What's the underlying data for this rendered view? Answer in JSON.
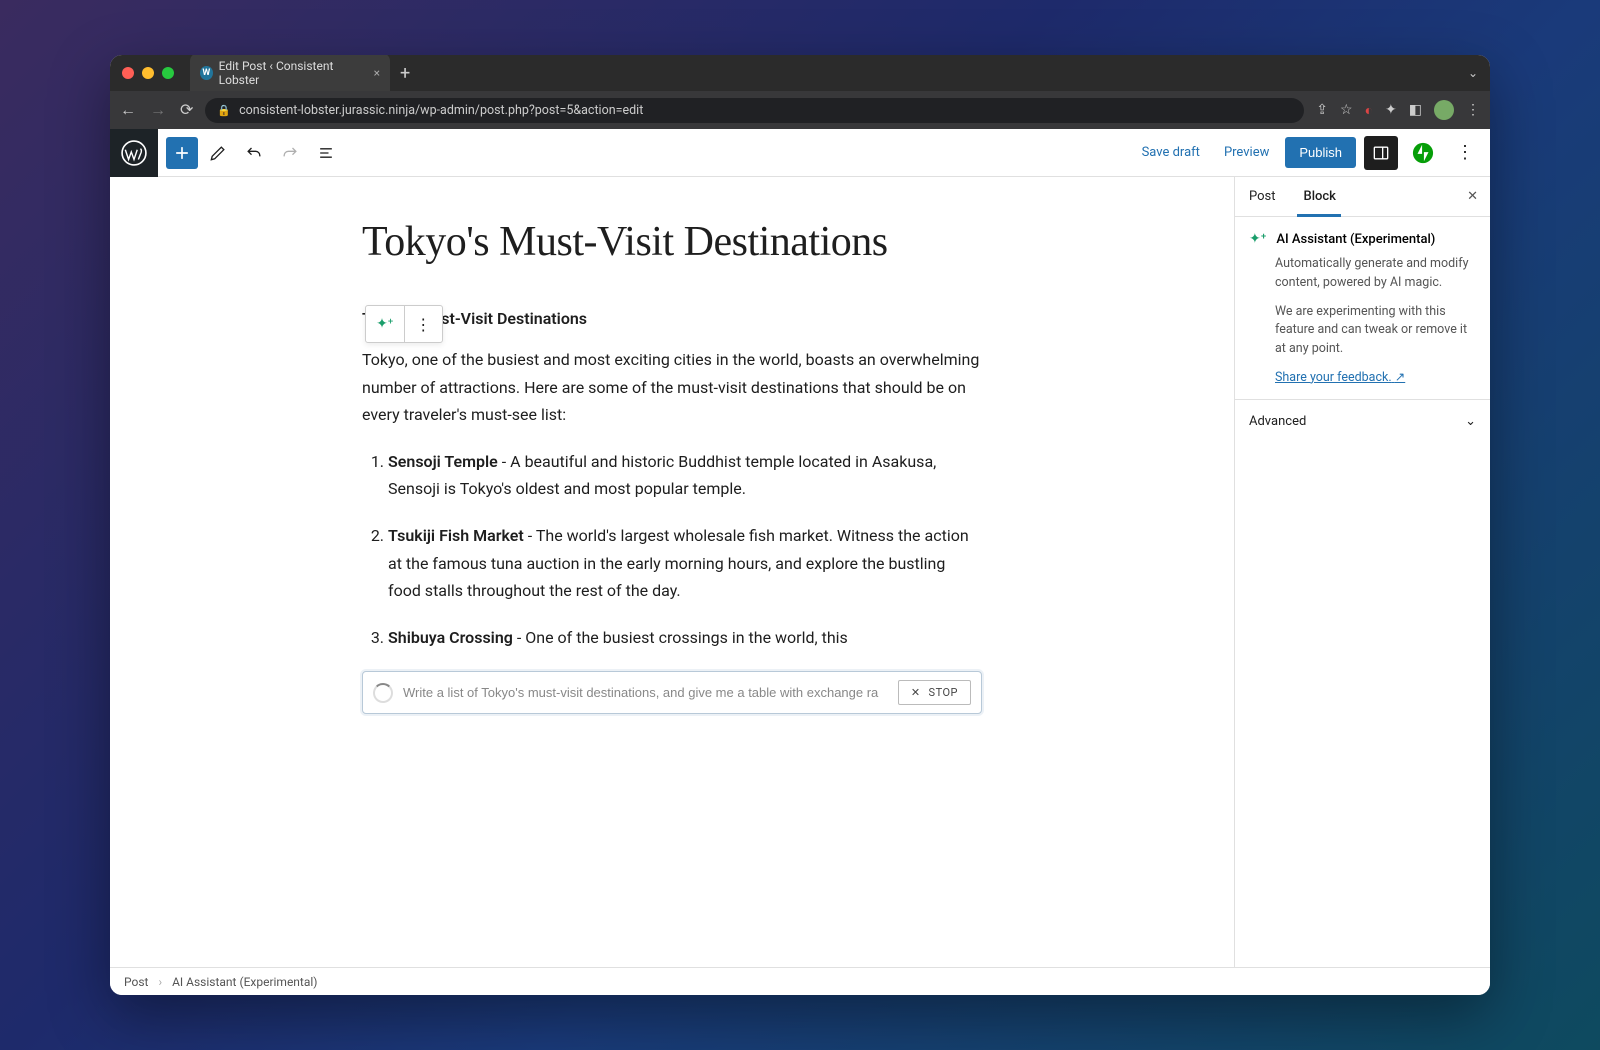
{
  "browser": {
    "tab_title": "Edit Post ‹ Consistent Lobster",
    "url": "consistent-lobster.jurassic.ninja/wp-admin/post.php?post=5&action=edit"
  },
  "toolbar": {
    "save_draft": "Save draft",
    "preview": "Preview",
    "publish": "Publish"
  },
  "post": {
    "title": "Tokyo's Must-Visit Destinations",
    "subheading": "Tokyo's Must-Visit Destinations",
    "intro": "Tokyo, one of the busiest and most exciting cities in the world, boasts an overwhelming number of attractions. Here are some of the must-visit destinations that should be on every traveler's must-see list:",
    "items": [
      {
        "name": "Sensoji Temple",
        "desc": " - A beautiful and historic Buddhist temple located in Asakusa, Sensoji is Tokyo's oldest and most popular temple."
      },
      {
        "name": "Tsukiji Fish Market",
        "desc": " - The world's largest wholesale fish market. Witness the action at the famous tuna auction in the early morning hours, and explore the bustling food stalls throughout the rest of the day."
      },
      {
        "name": "Shibuya Crossing",
        "desc": " - One of the busiest crossings in the world, this"
      }
    ]
  },
  "ai_input": {
    "value": "Write a list of Tokyo's must-visit destinations, and give me a table with exchange ra",
    "stop_label": "STOP"
  },
  "sidebar": {
    "tabs": {
      "post": "Post",
      "block": "Block"
    },
    "block": {
      "title": "AI Assistant (Experimental)",
      "desc1": "Automatically generate and modify content, powered by AI magic.",
      "desc2": "We are experimenting with this feature and can tweak or remove it at any point.",
      "feedback": "Share your feedback."
    },
    "advanced": "Advanced"
  },
  "breadcrumb": {
    "a": "Post",
    "b": "AI Assistant (Experimental)"
  }
}
